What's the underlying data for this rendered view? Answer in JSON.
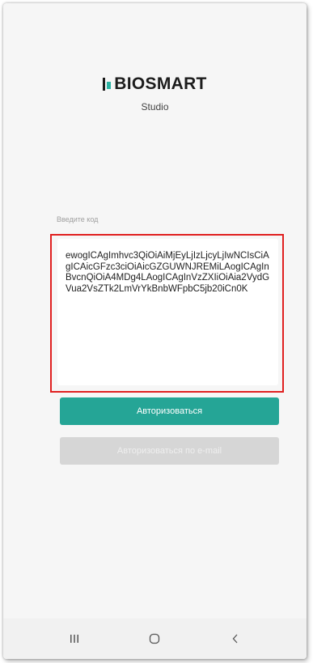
{
  "logo": {
    "brand": "BIOSMART",
    "subtitle": "Studio"
  },
  "code": {
    "label": "Введите код",
    "value": "ewogICAgImhvc3QiOiAiMjEyLjIzLjcyLjIwNCIsCiAgICAicGFzc3ciOiAicGZGUWNJREMiLAogICAgInBvcnQiOiA4MDg4LAogICAgInVzZXIiOiAia2VydGVua2VsZTk2LmVrYkBnbWFpbC5jb20iCn0K"
  },
  "buttons": {
    "authorize": "Авторизоваться",
    "authorize_email": "Авторизоваться по e-mail"
  },
  "colors": {
    "accent": "#25a596",
    "highlight": "#e02020",
    "disabled": "#d6d6d6"
  },
  "navbar": {
    "icons": [
      "recent-apps-icon",
      "home-icon",
      "back-icon"
    ]
  }
}
